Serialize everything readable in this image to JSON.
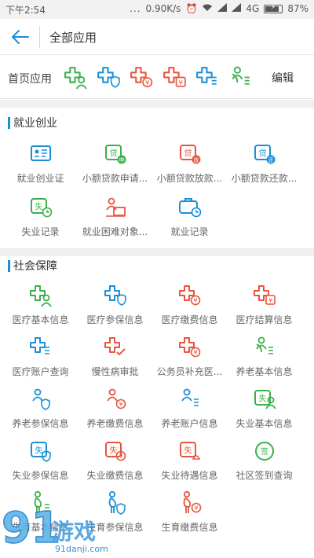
{
  "status_bar": {
    "time": "下午2:54",
    "dots": "...",
    "speed": "0.90K/s",
    "network": "4G",
    "battery": "87%",
    "battery_level": 0.87
  },
  "header": {
    "title": "全部应用"
  },
  "home_apps": {
    "label": "首页应用",
    "edit_label": "编辑",
    "icons": [
      "medical-info-icon",
      "medical-insurance-icon",
      "medical-payment-icon",
      "medical-settlement-icon",
      "medical-account-icon",
      "pension-info-icon"
    ]
  },
  "colors": {
    "green": "#3bb04a",
    "blue": "#1a8fd8",
    "red": "#e8553e",
    "accent": "#1a8fd8"
  },
  "sections": [
    {
      "title": "就业创业",
      "items": [
        {
          "label": "就业创业证",
          "icon": "card-icon"
        },
        {
          "label": "小额贷款申请...",
          "icon": "loan-apply-icon"
        },
        {
          "label": "小额贷款放款...",
          "icon": "loan-release-icon"
        },
        {
          "label": "小额贷款还款...",
          "icon": "loan-repay-icon"
        },
        {
          "label": "失业记录",
          "icon": "unemployment-record-icon"
        },
        {
          "label": "就业困难对象...",
          "icon": "hardship-icon"
        },
        {
          "label": "就业记录",
          "icon": "employment-record-icon"
        }
      ]
    },
    {
      "title": "社会保障",
      "items": [
        {
          "label": "医疗基本信息",
          "icon": "medical-info-icon"
        },
        {
          "label": "医疗参保信息",
          "icon": "medical-insurance-icon"
        },
        {
          "label": "医疗缴费信息",
          "icon": "medical-payment-icon"
        },
        {
          "label": "医疗结算信息",
          "icon": "medical-settlement-icon"
        },
        {
          "label": "医疗账户查询",
          "icon": "medical-account-icon"
        },
        {
          "label": "慢性病审批",
          "icon": "chronic-approval-icon"
        },
        {
          "label": "公务员补充医...",
          "icon": "civil-servant-icon"
        },
        {
          "label": "养老基本信息",
          "icon": "pension-info-icon"
        },
        {
          "label": "养老参保信息",
          "icon": "pension-insurance-icon"
        },
        {
          "label": "养老缴费信息",
          "icon": "pension-payment-icon"
        },
        {
          "label": "养老账户信息",
          "icon": "pension-account-icon"
        },
        {
          "label": "失业基本信息",
          "icon": "unemployment-info-icon"
        },
        {
          "label": "失业参保信息",
          "icon": "unemployment-insurance-icon"
        },
        {
          "label": "失业缴费信息",
          "icon": "unemployment-payment-icon"
        },
        {
          "label": "失业待遇信息",
          "icon": "unemployment-benefit-icon"
        },
        {
          "label": "社区签到查询",
          "icon": "community-checkin-icon"
        },
        {
          "label": "生育基本信息",
          "icon": "maternity-info-icon"
        },
        {
          "label": "生育参保信息",
          "icon": "maternity-insurance-icon"
        },
        {
          "label": "生育缴费信息",
          "icon": "maternity-payment-icon"
        }
      ]
    }
  ],
  "watermark": {
    "logo": "91游戏",
    "url": "91danji.com"
  }
}
